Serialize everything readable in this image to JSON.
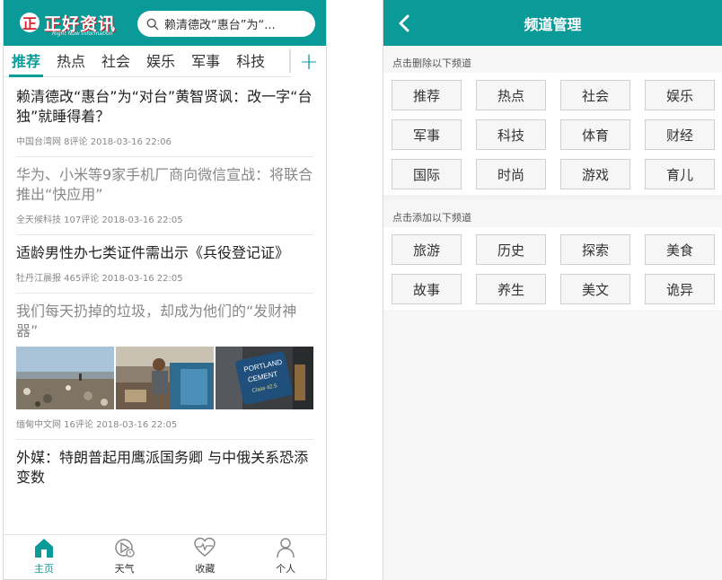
{
  "left_app": {
    "logo": {
      "title": "正好资讯",
      "subtitle": "Right Now Information"
    },
    "search": {
      "text": "赖清德改“惠台”为“..."
    },
    "tabs": [
      {
        "label": "推荐",
        "active": true
      },
      {
        "label": "热点",
        "active": false
      },
      {
        "label": "社会",
        "active": false
      },
      {
        "label": "娱乐",
        "active": false
      },
      {
        "label": "军事",
        "active": false
      },
      {
        "label": "科技",
        "active": false
      }
    ],
    "add_label": "+",
    "news": [
      {
        "title": "赖清德改“惠台”为“对台”黄智贤讽：改一字“台独”就睡得着？",
        "meta": "中国台湾网 8评论 2018-03-16 22:06",
        "read": false
      },
      {
        "title": "华为、小米等9家手机厂商向微信宣战：将联合推出“快应用”",
        "meta": "全天候科技 107评论 2018-03-16 22:05",
        "read": true
      },
      {
        "title": "适龄男性办七类证件需出示《兵役登记证》",
        "meta": "牡丹江晨报 465评论 2018-03-16 22:05",
        "read": false
      },
      {
        "title": "我们每天扔掉的垃圾，却成为他们的“发财神器”",
        "meta": "缅甸中文网 16评论 2018-03-16 22:05",
        "read": true,
        "has_images": true
      },
      {
        "title": "外媒：特朗普起用鹰派国务卿 与中俄关系恐添变数",
        "meta": "",
        "read": false
      }
    ],
    "thumb_sign": {
      "line1": "PORTLAND",
      "line2": "CEMENT",
      "line3": "Class 42.5"
    },
    "bottom_nav": [
      {
        "label": "主页",
        "icon": "home-icon",
        "active": true
      },
      {
        "label": "天气",
        "icon": "weather-icon",
        "active": false
      },
      {
        "label": "收藏",
        "icon": "favorite-heart-icon",
        "active": false
      },
      {
        "label": "个人",
        "icon": "user-icon",
        "active": false
      }
    ],
    "colors": {
      "accent": "#0a9a98",
      "logo_red": "#d9232a"
    }
  },
  "right_app": {
    "title": "频道管理",
    "remove_label": "点击删除以下频道",
    "add_label": "点击添加以下频道",
    "my_channels": [
      "推荐",
      "热点",
      "社会",
      "娱乐",
      "军事",
      "科技",
      "体育",
      "财经",
      "国际",
      "时尚",
      "游戏",
      "育儿"
    ],
    "more_channels": [
      "旅游",
      "历史",
      "探索",
      "美食",
      "故事",
      "养生",
      "美文",
      "诡异"
    ]
  }
}
